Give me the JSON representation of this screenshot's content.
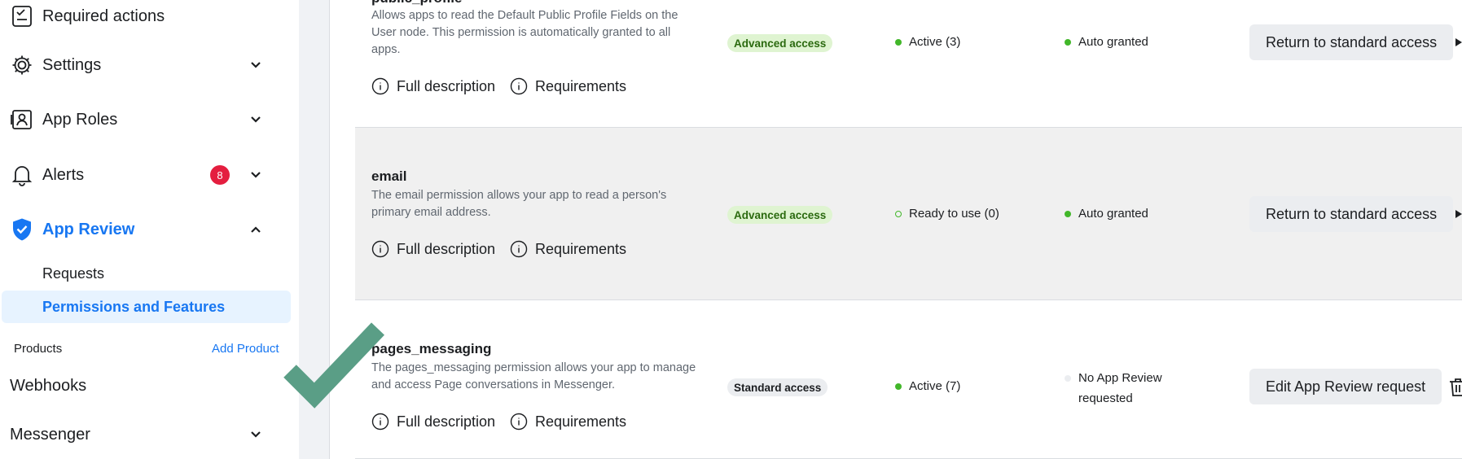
{
  "sidebar": {
    "required_actions": "Required actions",
    "settings": "Settings",
    "app_roles": "App Roles",
    "alerts": "Alerts",
    "alerts_badge": "8",
    "app_review": "App Review",
    "requests": "Requests",
    "permissions_features": "Permissions and Features",
    "products_label": "Products",
    "add_product": "Add Product",
    "webhooks": "Webhooks",
    "messenger": "Messenger"
  },
  "rows": [
    {
      "title": "public_profile",
      "description": "Allows apps to read the Default Public Profile Fields on the User node. This permission is automatically granted to all apps.",
      "full_description": "Full description",
      "requirements": "Requirements",
      "access": "Advanced access",
      "status": "Active (3)",
      "review": "Auto granted",
      "action": "Return to standard access"
    },
    {
      "title": "email",
      "description": "The email permission allows your app to read a person's primary email address.",
      "full_description": "Full description",
      "requirements": "Requirements",
      "access": "Advanced access",
      "status": "Ready to use (0)",
      "review": "Auto granted",
      "action": "Return to standard access"
    },
    {
      "title": "pages_messaging",
      "description": "The pages_messaging permission allows your app to manage and access Page conversations in Messenger.",
      "full_description": "Full description",
      "requirements": "Requirements",
      "access": "Standard access",
      "status": "Active (7)",
      "review": "No App Review requested",
      "action": "Edit App Review request"
    }
  ],
  "colors": {
    "accent": "#1877f2",
    "advanced_pill_bg": "#dff4d1",
    "advanced_pill_text": "#2b6a0f",
    "status_green": "#42b72a",
    "badge_red": "#e41e3f",
    "checkmark": "#5a9e86"
  }
}
